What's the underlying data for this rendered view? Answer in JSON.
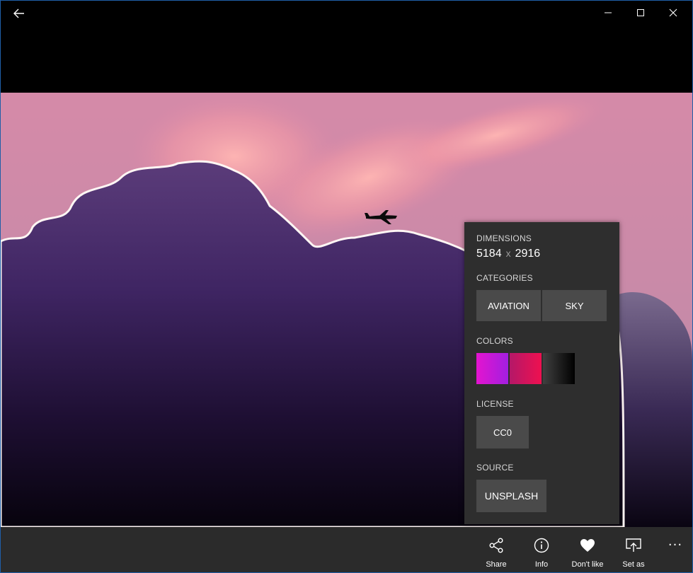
{
  "window": {
    "back_icon": "back-arrow-icon",
    "minimize_icon": "minimize-icon",
    "maximize_icon": "maximize-icon",
    "close_icon": "close-icon"
  },
  "info": {
    "dimensions_title": "DIMENSIONS",
    "width": "5184",
    "x": "x",
    "height": "2916",
    "categories_title": "CATEGORIES",
    "categories": [
      "AVIATION",
      "SKY"
    ],
    "colors_title": "COLORS",
    "colors": [
      "#d81fd1",
      "#d81560",
      "#2a2a2a"
    ],
    "license_title": "LICENSE",
    "license": "CC0",
    "source_title": "SOURCE",
    "source": "UNSPLASH"
  },
  "appbar": {
    "share": "Share",
    "info": "Info",
    "dislike": "Don't like",
    "setas": "Set as",
    "more": "···"
  }
}
